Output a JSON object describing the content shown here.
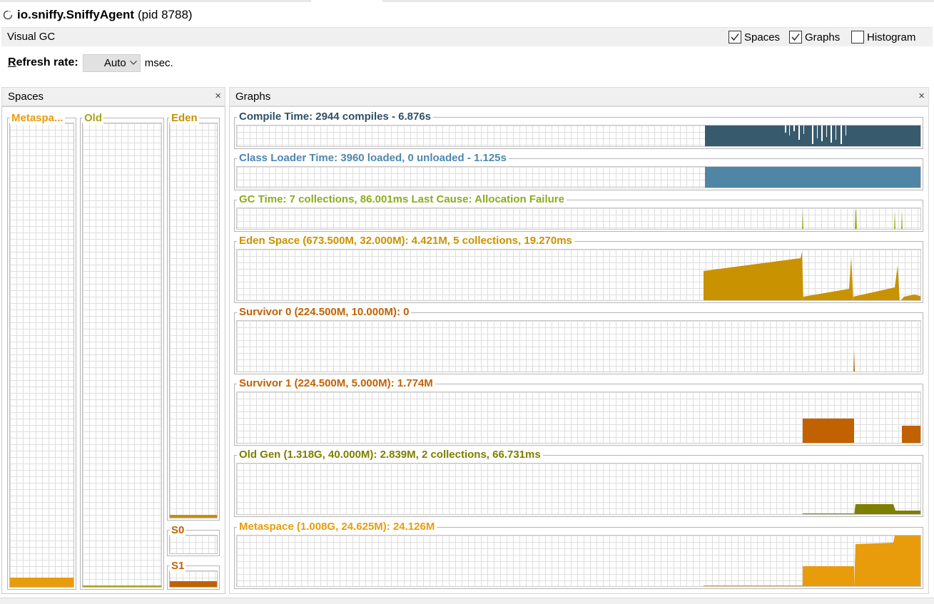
{
  "window": {
    "title": "io.sniffy.SniffyAgent",
    "pid": "(pid 8788)"
  },
  "tool": {
    "name": "Visual GC",
    "options": [
      {
        "label": "Spaces",
        "checked": true
      },
      {
        "label": "Graphs",
        "checked": true
      },
      {
        "label": "Histogram",
        "checked": false
      }
    ]
  },
  "refresh": {
    "label_u": "R",
    "label_rest": "efresh rate:",
    "value": "Auto",
    "unit": "msec."
  },
  "spaces_panel": {
    "title": "Spaces",
    "close": "×",
    "spaces": [
      {
        "key": "metaspace",
        "label": "Metaspa...",
        "color": "#e89c0c",
        "fill": 0.02
      },
      {
        "key": "old",
        "label": "Old",
        "color": "#a8a41a",
        "fill": 0.003
      },
      {
        "key": "eden",
        "label": "Eden",
        "color": "#c78f00",
        "fill": 0.007
      },
      {
        "key": "s0",
        "label": "S0",
        "color": "#c26100",
        "fill": 0
      },
      {
        "key": "s1",
        "label": "S1",
        "color": "#c26100",
        "fill": 0.35
      }
    ]
  },
  "graphs_panel": {
    "title": "Graphs",
    "close": "×",
    "graphs": [
      {
        "key": "compile",
        "label": "Compile Time: 2944 compiles - 6.876s",
        "label_color": "#2e5064",
        "color": "#385a6d"
      },
      {
        "key": "classloader",
        "label": "Class Loader Time: 3960 loaded, 0 unloaded - 1.125s",
        "label_color": "#4c87b0",
        "color": "#5185a6"
      },
      {
        "key": "gc",
        "label": "GC Time: 7 collections, 86.001ms Last Cause: Allocation Failure",
        "label_color": "#8cac1c",
        "color": "#96b01a"
      },
      {
        "key": "eden",
        "label": "Eden Space (673.500M, 32.000M): 4.421M, 5 collections, 19.270ms",
        "label_color": "#c99200",
        "color": "#c99200"
      },
      {
        "key": "s0",
        "label": "Survivor 0 (224.500M, 10.000M): 0",
        "label_color": "#c26100",
        "color": "#c26100"
      },
      {
        "key": "s1",
        "label": "Survivor 1 (224.500M, 5.000M): 1.774M",
        "label_color": "#c26100",
        "color": "#c26100"
      },
      {
        "key": "old",
        "label": "Old Gen (1.318G, 40.000M): 2.839M, 2 collections, 66.731ms",
        "label_color": "#7e7e00",
        "color": "#7e7e00"
      },
      {
        "key": "metaspace",
        "label": "Metaspace (1.008G, 24.625M): 24.126M",
        "label_color": "#e89c0c",
        "color": "#e89c0c"
      }
    ]
  }
}
